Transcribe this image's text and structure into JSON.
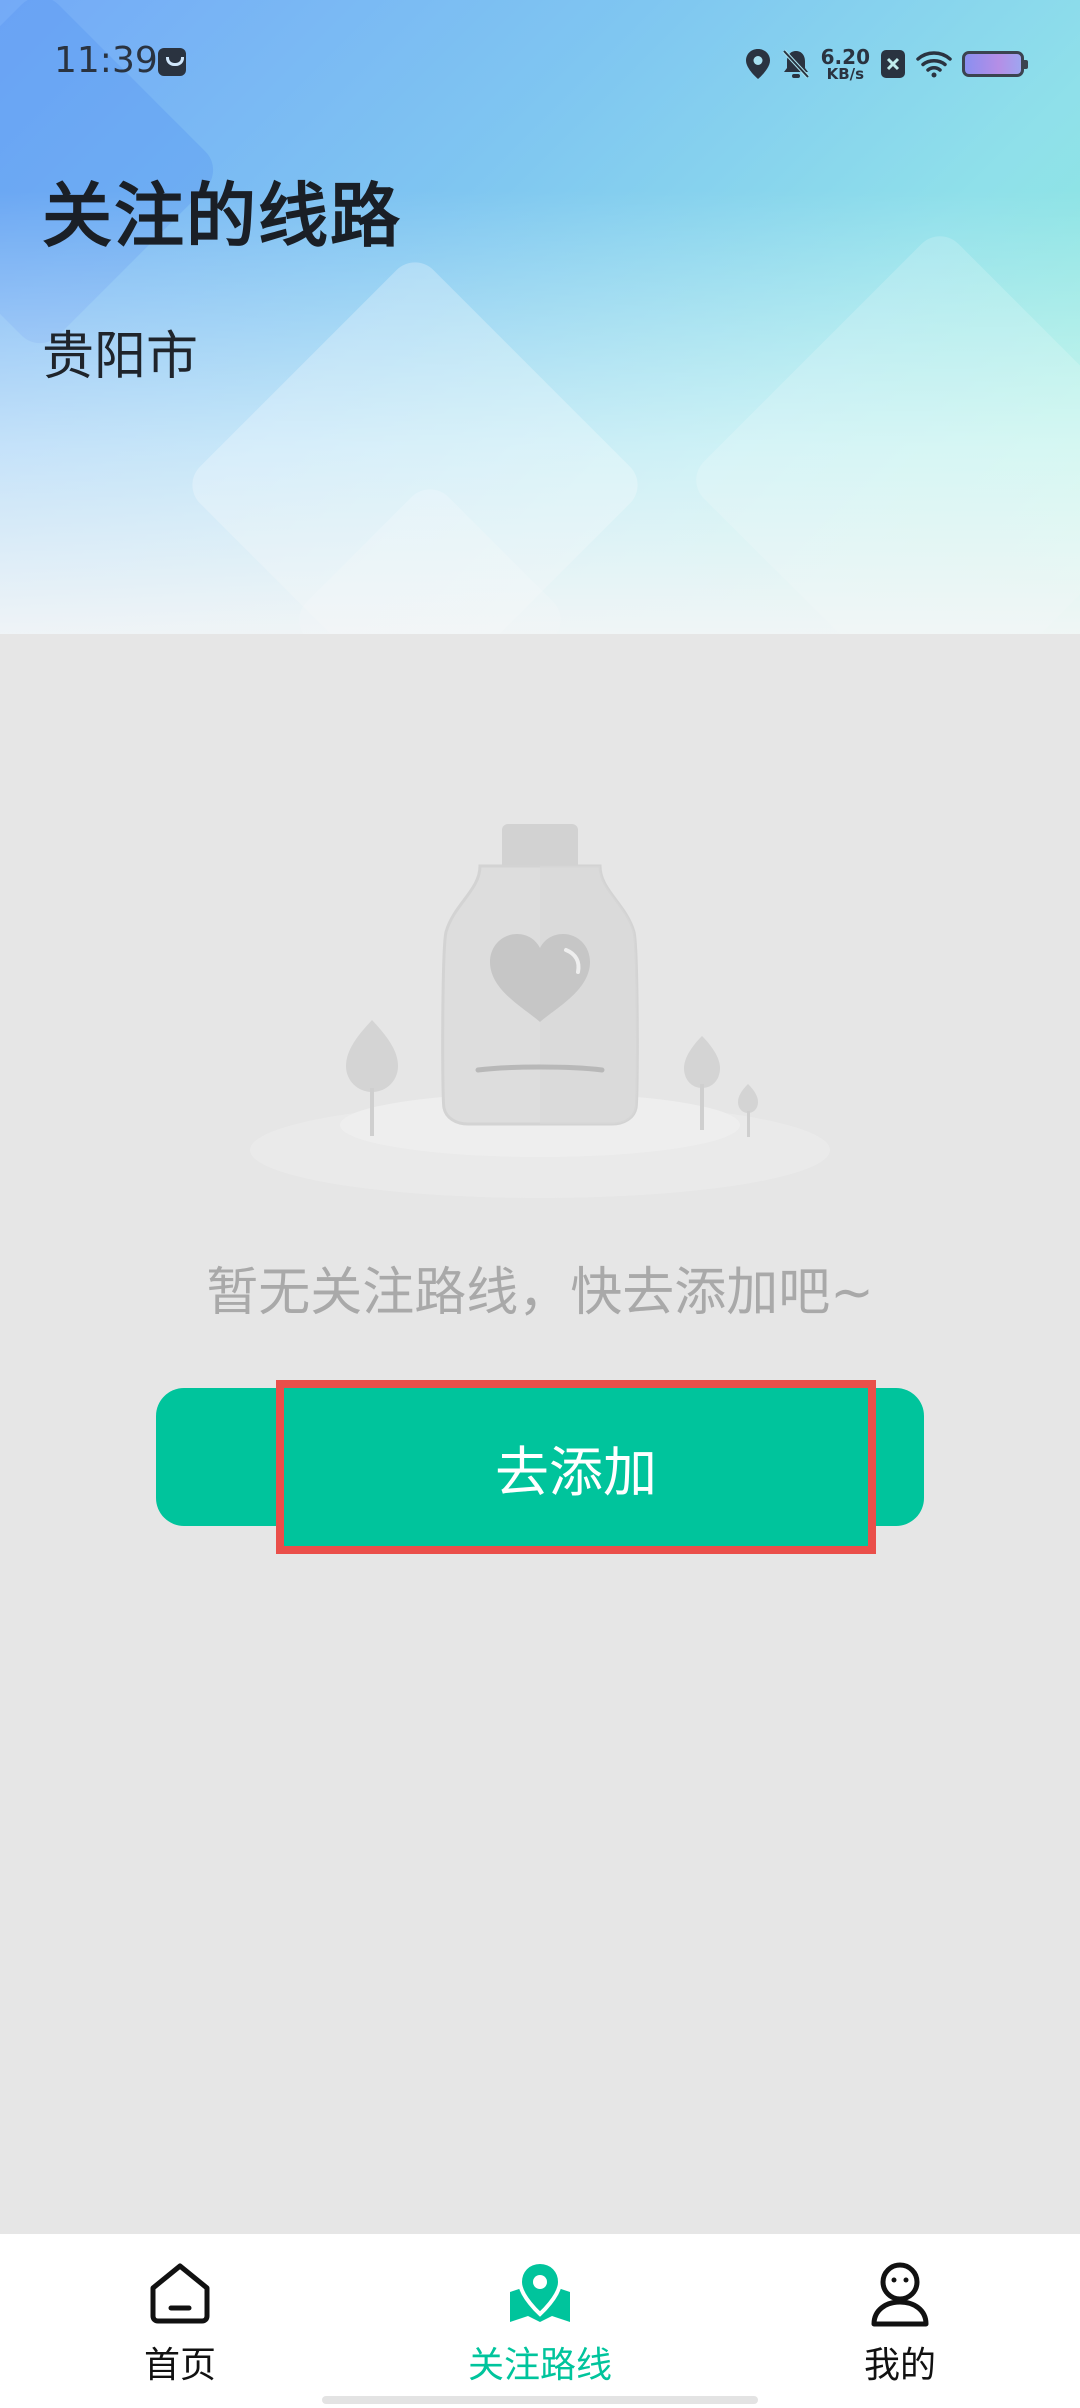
{
  "status_bar": {
    "time": "11:39",
    "net_speed_value": "6.20",
    "net_speed_unit": "KB/s",
    "icons": [
      "bag-icon",
      "location-icon",
      "mute-bell-icon",
      "sim-x-icon",
      "wifi-icon",
      "battery-icon"
    ]
  },
  "header": {
    "title": "关注的线路",
    "city": "贵阳市"
  },
  "empty_state": {
    "illustration": "empty-jar-heart-illustration",
    "message": "暂无关注路线，快去添加吧~",
    "button_label": "去添加"
  },
  "tabs": [
    {
      "label": "首页",
      "icon": "home-icon",
      "active": false
    },
    {
      "label": "关注路线",
      "icon": "route-map-icon",
      "active": true
    },
    {
      "label": "我的",
      "icon": "profile-icon",
      "active": false
    }
  ],
  "colors": {
    "accent": "#00c49c",
    "highlight_border": "#ea4f4a",
    "background": "#e6e6e6",
    "empty_text": "#a9a9a9"
  }
}
